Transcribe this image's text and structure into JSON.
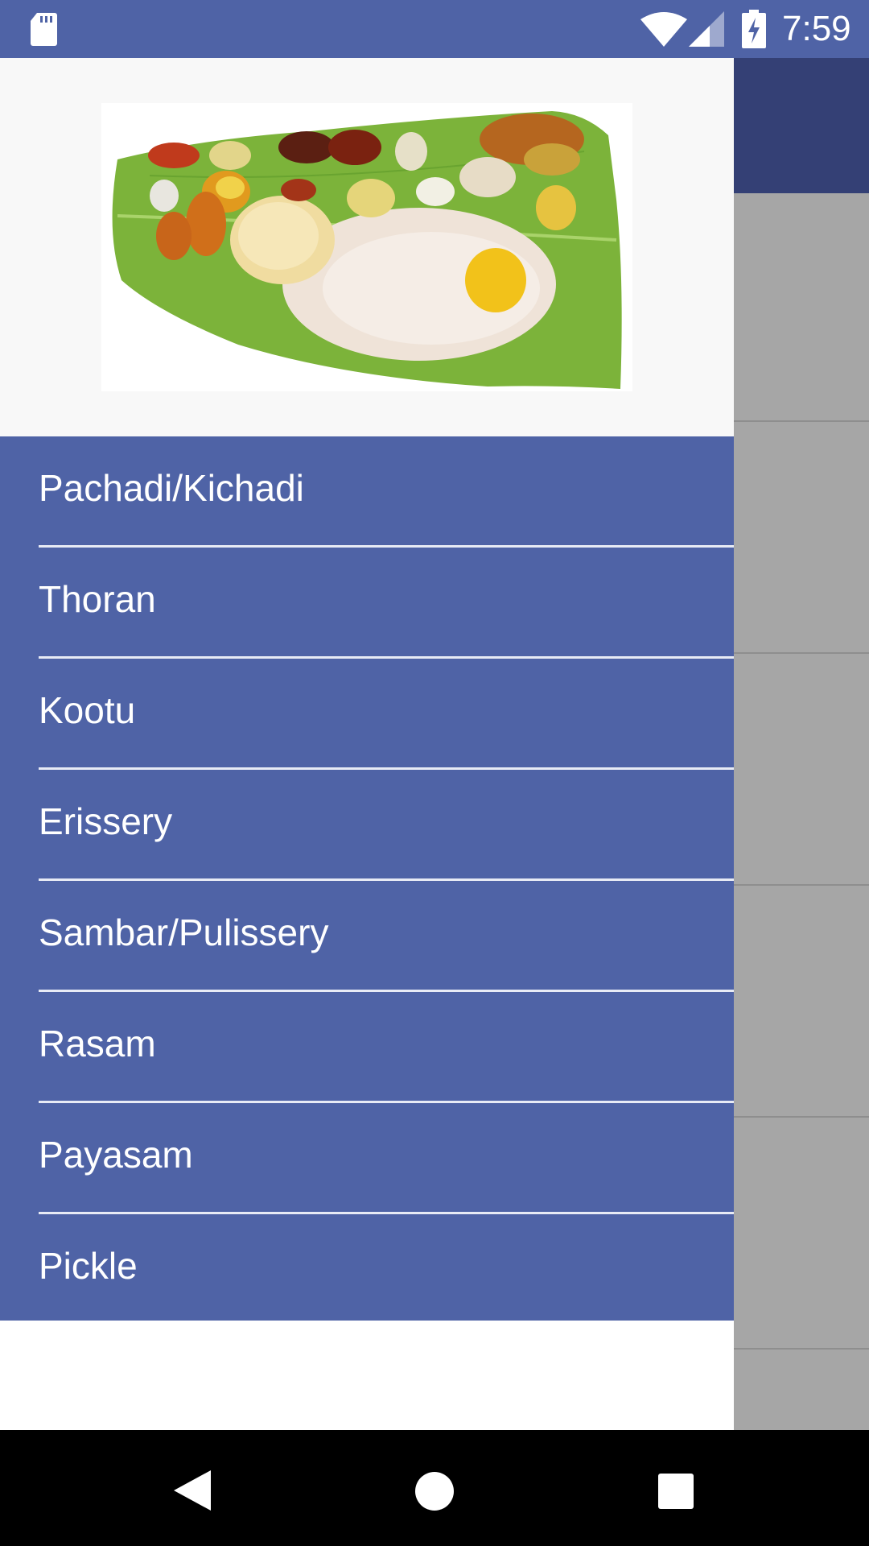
{
  "status_bar": {
    "time": "7:59",
    "icons": [
      "sd-card-icon",
      "wifi-icon",
      "cell-signal-icon",
      "battery-charging-icon"
    ]
  },
  "drawer": {
    "header_image": "onam-sadhya-banana-leaf-image",
    "menu_items": [
      {
        "label": "Pachadi/Kichadi"
      },
      {
        "label": "Thoran"
      },
      {
        "label": "Kootu"
      },
      {
        "label": "Erissery"
      },
      {
        "label": "Sambar/Pulissery"
      },
      {
        "label": "Rasam"
      },
      {
        "label": "Payasam"
      },
      {
        "label": "Pickle"
      }
    ]
  },
  "nav_bar": {
    "icons": [
      "back-icon",
      "home-icon",
      "recents-icon"
    ]
  },
  "colors": {
    "primary": "#4f63a6",
    "primary_dark": "#344075",
    "scrim_background": "#a6a6a6",
    "menu_text": "#ffffff"
  }
}
